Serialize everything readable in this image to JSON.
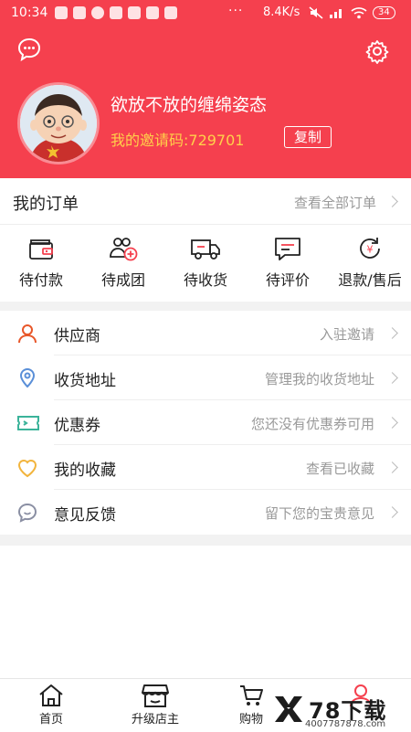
{
  "status_bar": {
    "time": "10:34",
    "dots": "···",
    "speed": "8.4K/s",
    "battery": "34"
  },
  "header": {
    "username": "欲放不放的缠绵姿态",
    "invite_label": "我的邀请码:729701",
    "copy_label": "复制"
  },
  "orders": {
    "title": "我的订单",
    "view_all": "查看全部订单",
    "items": [
      {
        "label": "待付款",
        "icon": "wallet-icon"
      },
      {
        "label": "待成团",
        "icon": "group-add-icon"
      },
      {
        "label": "待收货",
        "icon": "truck-icon"
      },
      {
        "label": "待评价",
        "icon": "comment-icon"
      },
      {
        "label": "退款/售后",
        "icon": "refund-icon"
      }
    ]
  },
  "menu": [
    {
      "label": "供应商",
      "hint": "入驻邀请",
      "icon": "person-icon"
    },
    {
      "label": "收货地址",
      "hint": "管理我的收货地址",
      "icon": "location-icon"
    },
    {
      "label": "优惠券",
      "hint": "您还没有优惠券可用",
      "icon": "coupon-icon"
    },
    {
      "label": "我的收藏",
      "hint": "查看已收藏",
      "icon": "heart-icon"
    },
    {
      "label": "意见反馈",
      "hint": "留下您的宝贵意见",
      "icon": "feedback-icon"
    }
  ],
  "tabbar": [
    {
      "label": "首页",
      "icon": "home-icon"
    },
    {
      "label": "升级店主",
      "icon": "store-icon"
    },
    {
      "label": "购物",
      "icon": "cart-icon"
    },
    {
      "label": "",
      "icon": "profile-icon"
    }
  ],
  "watermark": {
    "brand": "78下载",
    "url": "4007787878.com"
  },
  "colors": {
    "brand_red": "#f5404e",
    "invite_yellow": "#ffd04a",
    "menu_person": "#e8572a",
    "menu_location": "#5a8fd8",
    "menu_coupon": "#3bb39a",
    "menu_heart": "#f2b43c",
    "menu_feedback": "#8a8fa3"
  }
}
